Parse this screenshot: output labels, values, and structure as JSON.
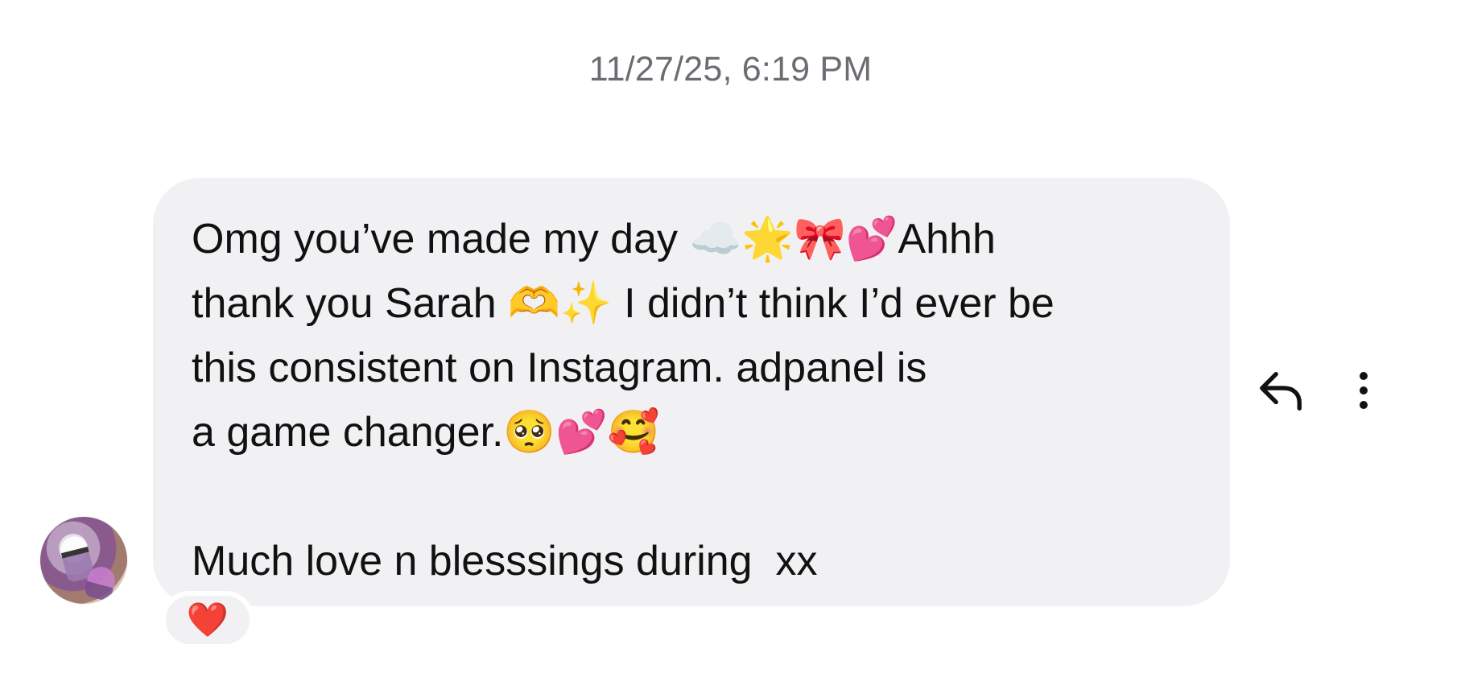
{
  "thread": {
    "timestamp": "11/27/25, 6:19 PM"
  },
  "message": {
    "text": "Omg you’ve made my day ☁️🌟🎀💕Ahhh\nthank you Sarah 🫶✨ I didn’t think I’d ever be\nthis consistent on Instagram. adpanel is\na game changer.🥺💕🥰\n\nMuch love n blesssings during  xx",
    "reaction": "❤️"
  },
  "icons": {
    "reply": "reply-arrow-icon",
    "more": "more-vertical-icon",
    "avatar": "profile-avatar"
  },
  "colors": {
    "bubble": "#f1f1f3",
    "timestamp": "#6b6d72",
    "text": "#111111"
  }
}
